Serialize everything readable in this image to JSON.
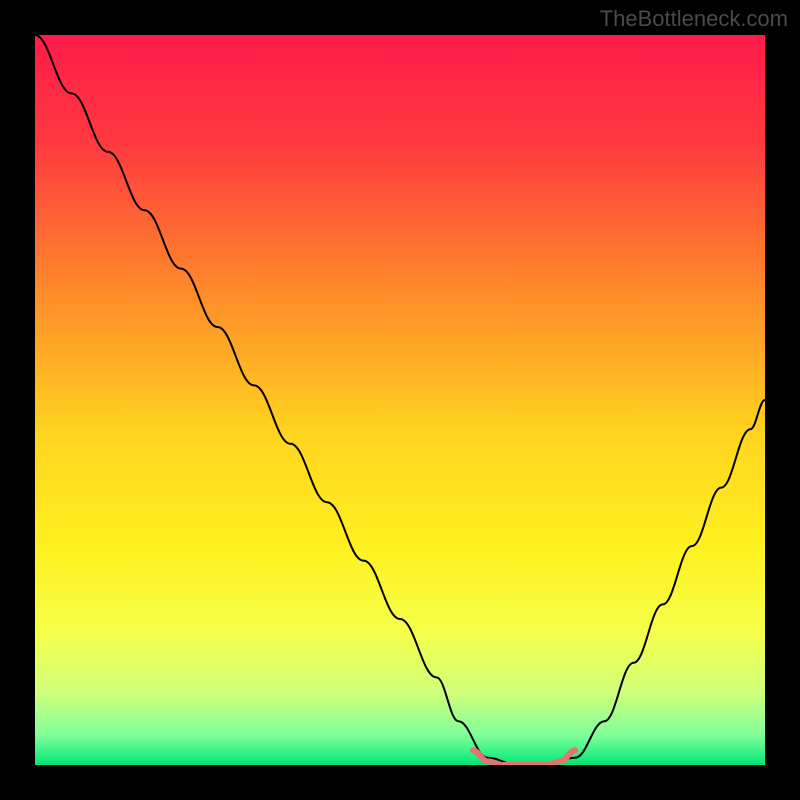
{
  "watermark": "TheBottleneck.com",
  "chart_data": {
    "type": "line",
    "title": "",
    "xlabel": "",
    "ylabel": "",
    "xlim": [
      0,
      100
    ],
    "ylim": [
      0,
      100
    ],
    "background_gradient": {
      "type": "vertical",
      "stops": [
        {
          "pos": 0.0,
          "color": "#ff1a4a"
        },
        {
          "pos": 0.15,
          "color": "#ff3a3f"
        },
        {
          "pos": 0.35,
          "color": "#ff8a2a"
        },
        {
          "pos": 0.55,
          "color": "#ffd51f"
        },
        {
          "pos": 0.7,
          "color": "#fff01f"
        },
        {
          "pos": 0.82,
          "color": "#f5ff4a"
        },
        {
          "pos": 0.9,
          "color": "#d0ff7a"
        },
        {
          "pos": 0.96,
          "color": "#7eff9a"
        },
        {
          "pos": 1.0,
          "color": "#00e676"
        }
      ]
    },
    "series": [
      {
        "name": "bottleneck-curve",
        "color": "#000000",
        "width": 2,
        "x": [
          0,
          5,
          10,
          15,
          20,
          25,
          30,
          35,
          40,
          45,
          50,
          55,
          58,
          62,
          66,
          70,
          74,
          78,
          82,
          86,
          90,
          94,
          98,
          100
        ],
        "y": [
          100,
          92,
          84,
          76,
          68,
          60,
          52,
          44,
          36,
          28,
          20,
          12,
          6,
          1,
          0,
          0,
          1,
          6,
          14,
          22,
          30,
          38,
          46,
          50
        ]
      },
      {
        "name": "optimal-zone",
        "color": "#e57373",
        "width": 6,
        "x": [
          60,
          62,
          64,
          66,
          68,
          70,
          72,
          74
        ],
        "y": [
          2,
          0.5,
          0,
          0,
          0,
          0,
          0.5,
          2
        ]
      }
    ]
  }
}
